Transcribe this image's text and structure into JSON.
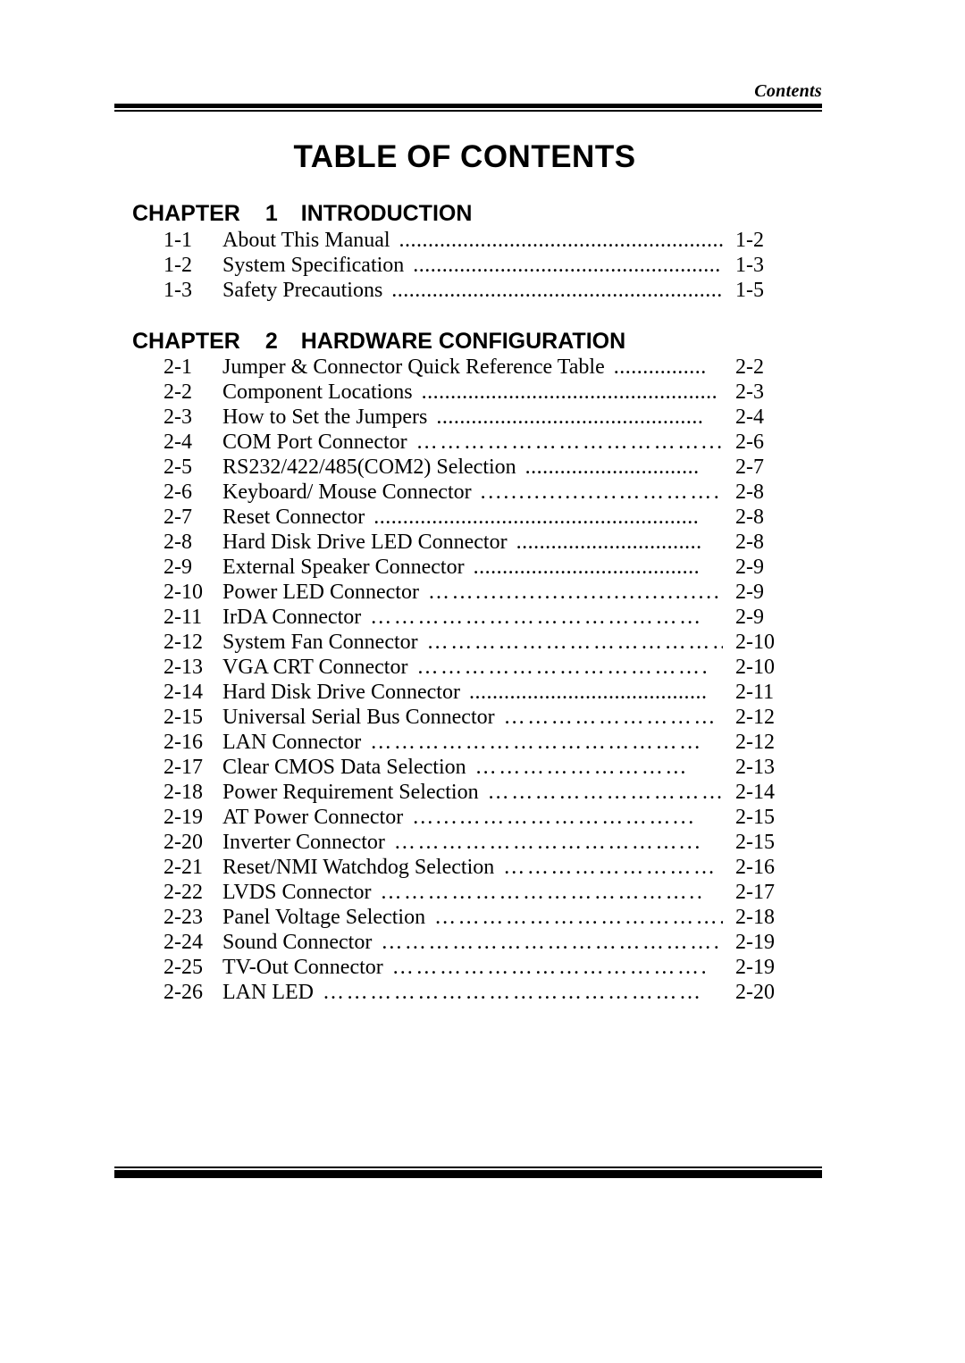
{
  "header": {
    "running_head": "Contents"
  },
  "title": "TABLE OF CONTENTS",
  "chapters": [
    {
      "label": "CHAPTER",
      "number": "1",
      "name": "INTRODUCTION",
      "entries": [
        {
          "num": "1-1",
          "title": "About This Manual",
          "leader": "..........................................................",
          "page": "1-2"
        },
        {
          "num": "1-2",
          "title": "System Specification",
          "leader": ".....................................................",
          "page": "1-3"
        },
        {
          "num": "1-3",
          "title": "Safety Precautions",
          "leader": ".........................................................",
          "page": "1-5"
        }
      ]
    },
    {
      "label": "CHAPTER",
      "number": "2",
      "name": "HARDWARE CONFIGURATION",
      "entries": [
        {
          "num": "2-1",
          "title": "Jumper & Connector Quick Reference Table",
          "leader": "................",
          "page": "2-2"
        },
        {
          "num": "2-2",
          "title": "Component Locations",
          "leader": "...................................................",
          "page": "2-3"
        },
        {
          "num": "2-3",
          "title": "How to Set the Jumpers",
          "leader": "..............................................",
          "page": "2-4"
        },
        {
          "num": "2-4",
          "title": "COM Port Connector",
          "leader": "………………………………...",
          "page": "2-6"
        },
        {
          "num": "2-5",
          "title": "RS232/422/485(COM2) Selection",
          "leader": "..............................",
          "page": "2-7"
        },
        {
          "num": "2-6",
          "title": "Keyboard/ Mouse Connector",
          "leader": "..................…………..",
          "page": "2-8"
        },
        {
          "num": "2-7",
          "title": "Reset Connector",
          "leader": "........................................................",
          "page": "2-8"
        },
        {
          "num": "2-8",
          "title": "Hard Disk Drive LED Connector",
          "leader": "................................",
          "page": "2-8"
        },
        {
          "num": "2-9",
          "title": "External Speaker Connector",
          "leader": ".......................................",
          "page": "2-9"
        },
        {
          "num": "2-10",
          "title": "Power LED Connector",
          "leader": "……...........................................",
          "page": "2-9"
        },
        {
          "num": "2-11",
          "title": "IrDA Connector",
          "leader": "……………………………………",
          "page": "2-9"
        },
        {
          "num": "2-12",
          "title": "System Fan Connector",
          "leader": "…………………………………",
          "page": "2-10"
        },
        {
          "num": "2-13",
          "title": "VGA CRT Connector",
          "leader": "……………………………….",
          "page": "2-10"
        },
        {
          "num": "2-14",
          "title": "Hard Disk Drive Connector",
          "leader": ".........................................",
          "page": "2-11"
        },
        {
          "num": "2-15",
          "title": "Universal Serial Bus Connector",
          "leader": "………………………",
          "page": "2-12"
        },
        {
          "num": "2-16",
          "title": "LAN Connector",
          "leader": "……………………………………",
          "page": "2-12"
        },
        {
          "num": "2-17",
          "title": "Clear CMOS Data Selection",
          "leader": "………………………",
          "page": "2-13"
        },
        {
          "num": "2-18",
          "title": "Power Requirement Selection",
          "leader": "…………………………",
          "page": "2-14"
        },
        {
          "num": "2-19",
          "title": "AT Power Connector",
          "leader": "…...………………………...",
          "page": "2-15"
        },
        {
          "num": "2-20",
          "title": "Inverter Connector",
          "leader": "………………………………...",
          "page": "2-15"
        },
        {
          "num": "2-21",
          "title": "Reset/NMI Watchdog Selection",
          "leader": "………………………",
          "page": "2-16"
        },
        {
          "num": "2-22",
          "title": "LVDS Connector",
          "leader": "…………………………………..",
          "page": "2-17"
        },
        {
          "num": "2-23",
          "title": "Panel Voltage Selection",
          "leader": "………………………………..",
          "page": "2-18"
        },
        {
          "num": "2-24",
          "title": "Sound Connector",
          "leader": "…………………………………….",
          "page": "2-19"
        },
        {
          "num": "2-25",
          "title": "TV-Out Connector",
          "leader": "………………………………….",
          "page": "2-19"
        },
        {
          "num": "2-26",
          "title": "LAN LED",
          "leader": "…………………………………………",
          "page": "2-20"
        }
      ]
    }
  ],
  "colors": {
    "text": "#000000",
    "background": "#ffffff",
    "rule": "#000000"
  }
}
